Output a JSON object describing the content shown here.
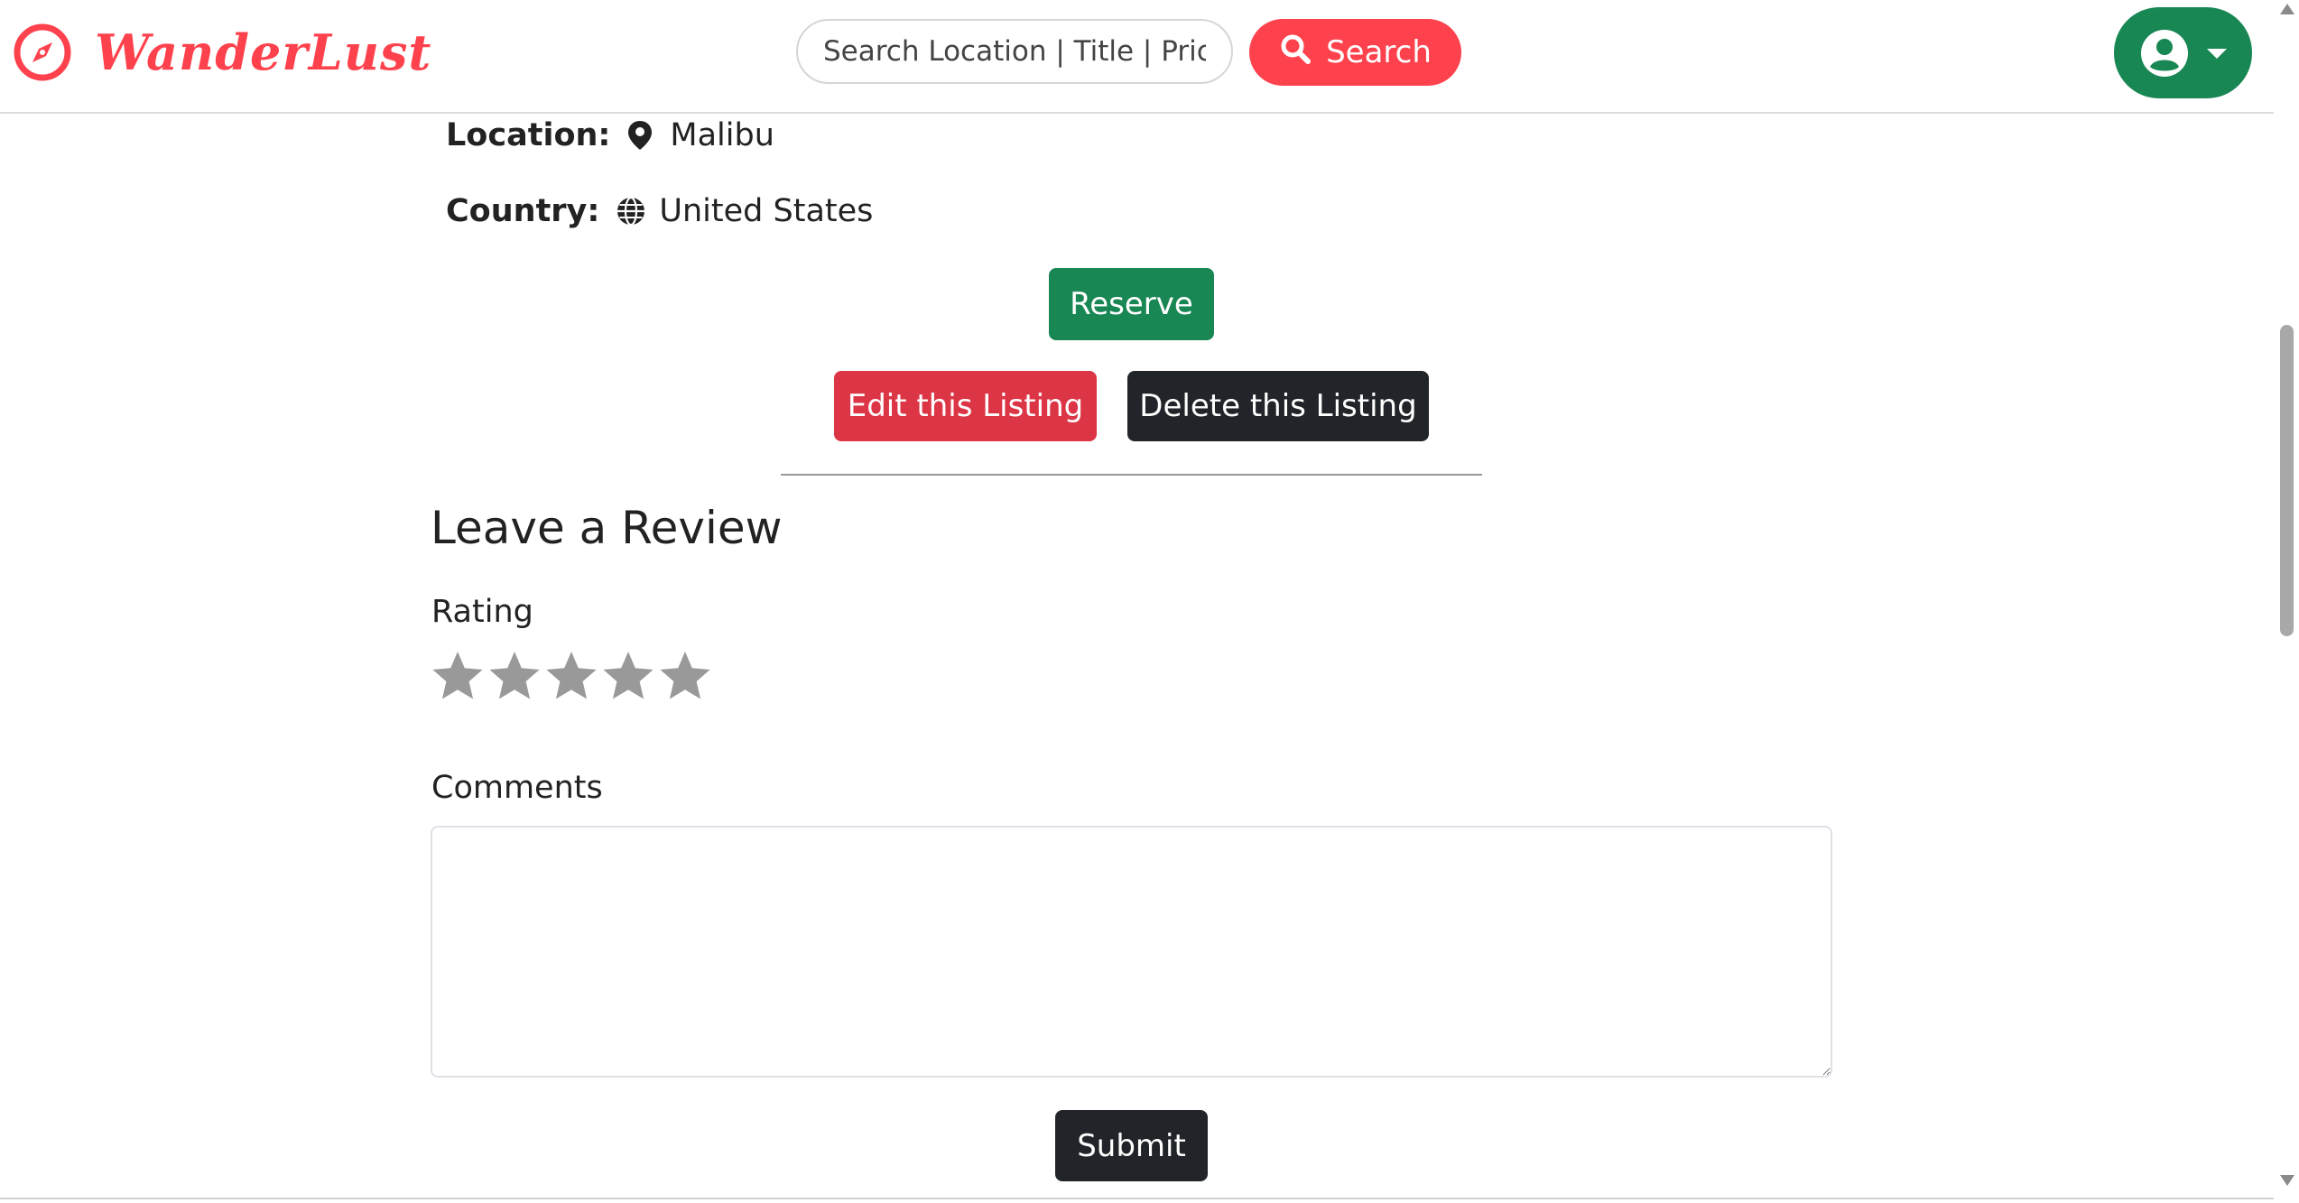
{
  "navbar": {
    "brand_name": "WanderLust",
    "brand_color": "#fe424d",
    "brand_icon": "compass-icon",
    "search": {
      "placeholder": "Search Location | Title | Price",
      "button_label": "Search",
      "button_icon": "search-icon"
    },
    "profile_icon": "user-circle-icon",
    "profile_dropdown_icon": "caret-down-icon"
  },
  "listing": {
    "location_label": "Location:",
    "location_icon": "map-pin-icon",
    "location_value": "Malibu",
    "country_label": "Country:",
    "country_icon": "globe-icon",
    "country_value": "United States"
  },
  "actions": {
    "reserve_label": "Reserve",
    "edit_label": "Edit this Listing",
    "delete_label": "Delete this Listing"
  },
  "review_form": {
    "heading": "Leave a Review",
    "rating_label": "Rating",
    "rating_max": 5,
    "rating_value": 0,
    "comments_label": "Comments",
    "comments_value": "",
    "submit_label": "Submit"
  },
  "colors": {
    "accent_red": "#fe424d",
    "success_green": "#198754",
    "danger_red": "#dc3545",
    "dark": "#212529",
    "star_inactive": "#999999"
  }
}
